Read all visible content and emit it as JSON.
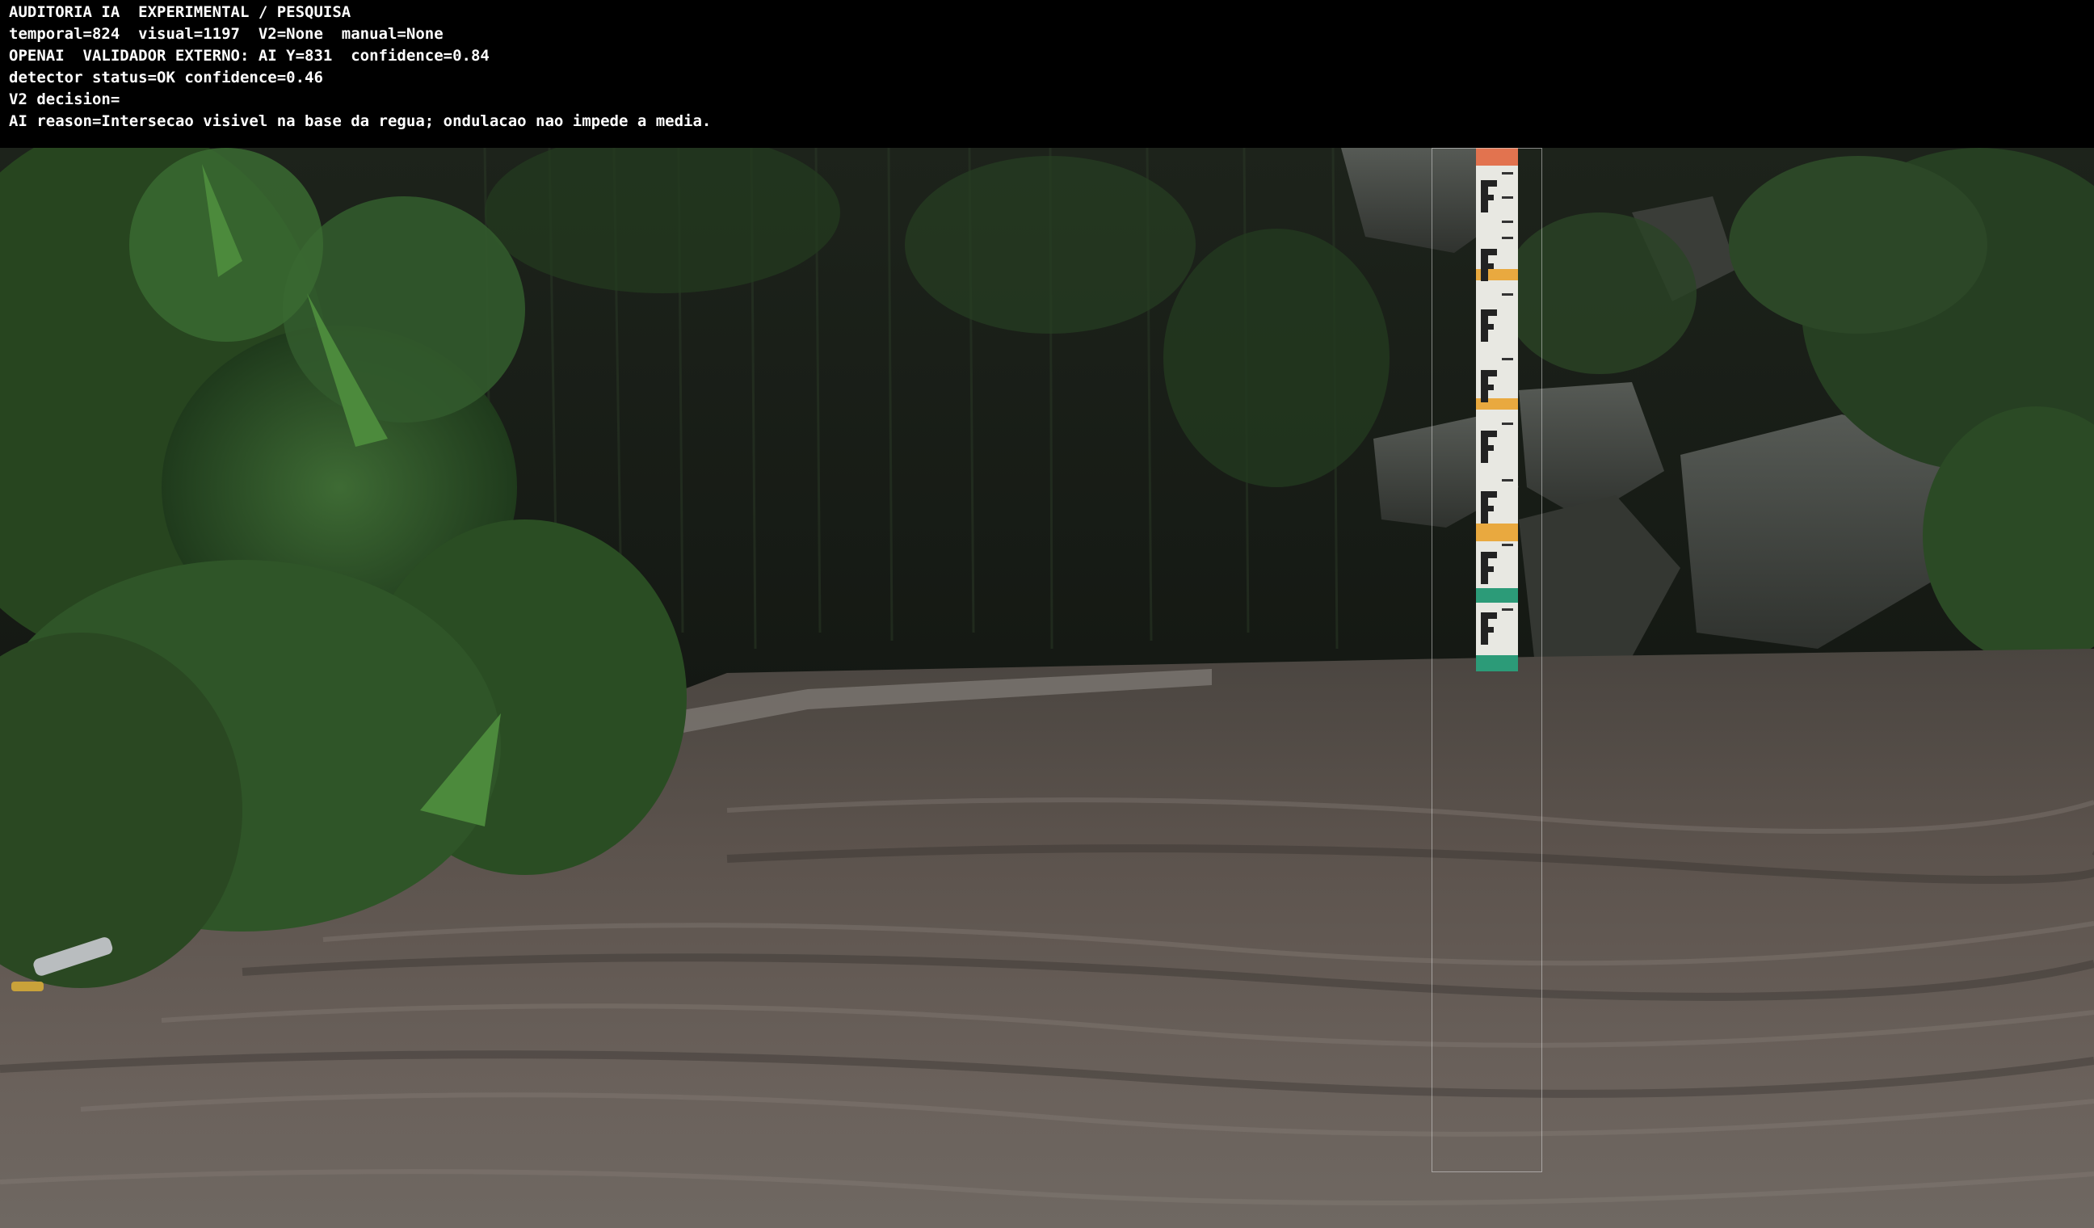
{
  "overlay": {
    "lines": [
      "AUDITORIA IA  EXPERIMENTAL / PESQUISA",
      "temporal=824  visual=1197  V2=None  manual=None",
      "OPENAI  VALIDADOR EXTERNO: AI Y=831  confidence=0.84",
      "detector status=OK confidence=0.46",
      "V2 decision=",
      "AI reason=Intersecao visivel na base da regua; ondulacao nao impede a media."
    ]
  },
  "scene": {
    "icons": [
      "staff-gauge-icon",
      "river-icon",
      "vegetation-icon",
      "rock-icon",
      "bottle-icon"
    ],
    "colors": {
      "water": "#5f5650",
      "foliage": "#2e4a26",
      "rock": "#3f423d",
      "gauge_white": "#e8e8e2",
      "gauge_red": "#e2734f",
      "gauge_orange": "#e9a93f",
      "gauge_green": "#2c9b78",
      "roi_border": "#dcdcdc"
    }
  }
}
